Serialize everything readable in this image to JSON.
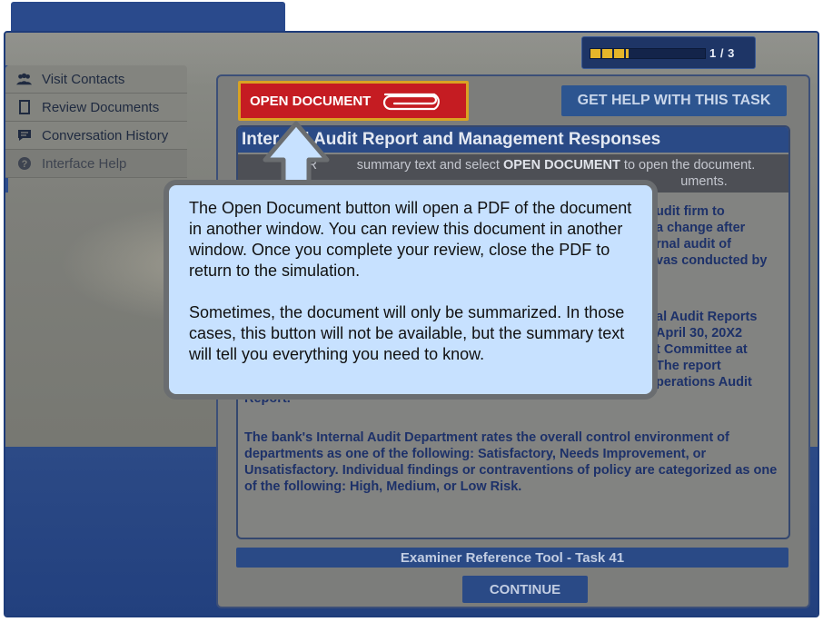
{
  "progress": {
    "label": "1 / 3",
    "fraction": 0.33
  },
  "nav": {
    "items": [
      {
        "label": "Visit Contacts",
        "icon": "people-icon"
      },
      {
        "label": "Review Documents",
        "icon": "document-icon"
      },
      {
        "label": "Conversation History",
        "icon": "chat-icon"
      },
      {
        "label": "Interface Help",
        "icon": "help-icon"
      }
    ]
  },
  "toolbar": {
    "open_document": "OPEN DOCUMENT",
    "get_help": "GET HELP WITH THIS TASK"
  },
  "document": {
    "title_left": "Inter",
    "title_right": "l Audit Report and Management Responses",
    "instruction_left": "R",
    "instruction_mid": "summary text and select",
    "instruction_bold": "OPEN DOCUMENT",
    "instruction_end": "to open the document.",
    "instruction_line2": "uments.",
    "frag1": [
      "udit firm to",
      "a change after",
      "rnal audit of",
      "vas conducted by"
    ],
    "frag2": [
      "al Audit Reports",
      "April 30, 20X2",
      "t Committee at",
      "The report",
      "perations Audit"
    ],
    "frag3": "Report.",
    "paragraph": "The bank's Internal Audit Department rates the overall control environment of departments as one of the following: Satisfactory, Needs Improvement, or Unsatisfactory. Individual findings or contraventions of policy are categorized as one of the following: High, Medium, or Low Risk."
  },
  "reference_bar": "Examiner Reference Tool - Task 41",
  "continue_label": "CONTINUE",
  "tooltip": {
    "p1": "The Open Document button will open a PDF of the document in another window. You can review this document in another window. Once you complete your review, close the PDF to return to the simulation.",
    "p2": "Sometimes, the document will only be summarized. In those cases, this button will not be available, but the summary text will tell you everything you need to know."
  },
  "colors": {
    "accent": "#2a4a86",
    "open_doc_red": "#c51c22",
    "open_doc_border": "#d9a323",
    "tooltip_bg": "#c7e1ff"
  }
}
